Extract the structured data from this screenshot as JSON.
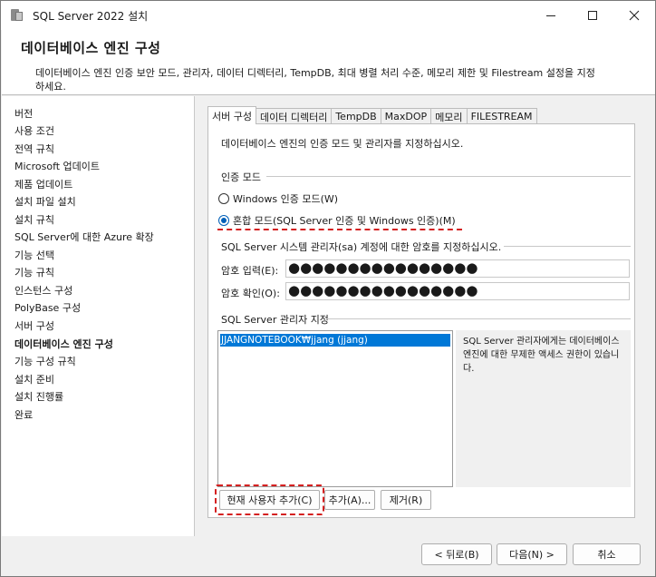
{
  "window": {
    "title": "SQL Server 2022 설치"
  },
  "header": {
    "title": "데이터베이스 엔진 구성",
    "description": "데이터베이스 엔진 인증 보안 모드, 관리자, 데이터 디렉터리, TempDB, 최대 병렬 처리 수준, 메모리 제한 및 Filestream 설정을 지정하세요."
  },
  "nav": {
    "items": [
      {
        "label": "버전"
      },
      {
        "label": "사용 조건"
      },
      {
        "label": "전역 규칙"
      },
      {
        "label": "Microsoft 업데이트"
      },
      {
        "label": "제품 업데이트"
      },
      {
        "label": "설치 파일 설치"
      },
      {
        "label": "설치 규칙"
      },
      {
        "label": "SQL Server에 대한 Azure 확장"
      },
      {
        "label": "기능 선택"
      },
      {
        "label": "기능 규칙"
      },
      {
        "label": "인스턴스 구성"
      },
      {
        "label": "PolyBase 구성"
      },
      {
        "label": "서버 구성"
      },
      {
        "label": "데이터베이스 엔진 구성"
      },
      {
        "label": "기능 구성 규칙"
      },
      {
        "label": "설치 준비"
      },
      {
        "label": "설치 진행률"
      },
      {
        "label": "완료"
      }
    ],
    "current": "데이터베이스 엔진 구성"
  },
  "tabs": [
    {
      "label": "서버 구성"
    },
    {
      "label": "데이터 디렉터리"
    },
    {
      "label": "TempDB"
    },
    {
      "label": "MaxDOP"
    },
    {
      "label": "메모리"
    },
    {
      "label": "FILESTREAM"
    }
  ],
  "server_config": {
    "intro": "데이터베이스 엔진의 인증 모드 및 관리자를 지정하십시오.",
    "auth_group_label": "인증 모드",
    "windows_auth_label": "Windows 인증 모드(W)",
    "mixed_auth_label": "혼합 모드(SQL Server 인증 및 Windows 인증)(M)",
    "selected_auth": "mixed",
    "sa_group_label": "SQL Server 시스템 관리자(sa) 계정에 대한 암호를 지정하십시오.",
    "password_label": "암호 입력(E):",
    "password_value": "●●●●●●●●●●●●●●●●",
    "confirm_label": "암호 확인(O):",
    "confirm_value": "●●●●●●●●●●●●●●●●",
    "admins_group_label": "SQL Server 관리자 지정",
    "admins": [
      "JJANGNOTEBOOK₩jjang (jjang)"
    ],
    "admins_info": "SQL Server 관리자에게는 데이터베이스 엔진에 대한 무제한 액세스 권한이 있습니다.",
    "add_current_user_label": "현재 사용자 추가(C)",
    "add_label": "추가(A)...",
    "remove_label": "제거(R)"
  },
  "footer": {
    "back_label": "< 뒤로(B)",
    "next_label": "다음(N) >",
    "cancel_label": "취소"
  },
  "colors": {
    "selection": "#0078d7",
    "highlight_annotation": "#d42020"
  }
}
